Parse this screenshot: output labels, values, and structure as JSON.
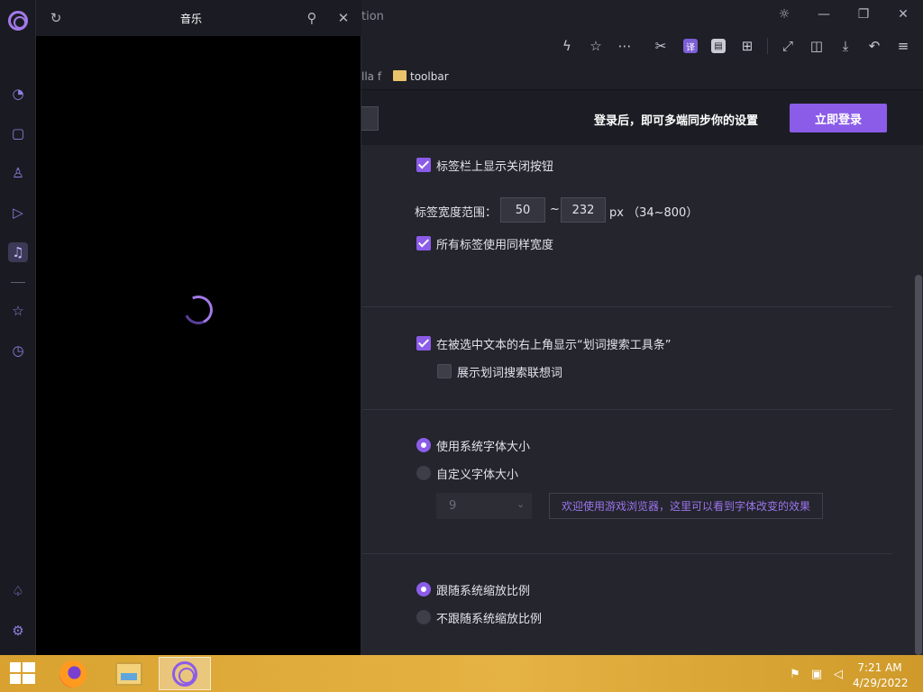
{
  "titlebar": {
    "controls": [
      "brightness-icon",
      "minimize-icon",
      "restore-icon",
      "close-icon"
    ]
  },
  "address": {
    "partial_text": "tion"
  },
  "toolbar": {
    "translate_badge": "译"
  },
  "bookmarks": {
    "partial_item": "lla f",
    "folder_label": "toolbar"
  },
  "banner": {
    "text": "登录后，即可多端同步你的设置",
    "login_label": "立即登录"
  },
  "tabs_section": {
    "show_close_btn": {
      "label": "标签栏上显示关闭按钮",
      "checked": true
    },
    "width_range_label": "标签宽度范围：",
    "width_min": "50",
    "tilde": "~",
    "width_max": "232",
    "unit_hint": "px （34~800）",
    "same_width": {
      "label": "所有标签使用同样宽度",
      "checked": true
    }
  },
  "selection_section": {
    "show_toolbar": {
      "label": "在被选中文本的右上角显示“划词搜索工具条”",
      "checked": true
    },
    "show_suggest": {
      "label": "展示划词搜索联想词",
      "checked": false
    }
  },
  "font_section": {
    "system_font": {
      "label": "使用系统字体大小",
      "selected": true
    },
    "custom_font": {
      "label": "自定义字体大小",
      "selected": false
    },
    "font_size_value": "9",
    "preview_text": "欢迎使用游戏浏览器，这里可以看到字体改变的效果"
  },
  "zoom_section": {
    "follow_system": {
      "label": "跟随系统缩放比例",
      "selected": true
    },
    "not_follow": {
      "label": "不跟随系统缩放比例",
      "selected": false
    }
  },
  "music_panel": {
    "title": "音乐",
    "loading": true
  },
  "sidebar": {
    "items": [
      "dashboard-icon",
      "screen-icon",
      "user-add-icon",
      "video-icon",
      "music-icon",
      "star-icon",
      "history-icon",
      "thumbs-up-icon",
      "settings-icon"
    ],
    "active": "music-icon"
  },
  "taskbar": {
    "apps": [
      "firefox",
      "file-explorer",
      "game-browser"
    ],
    "active_app": "game-browser",
    "clock_time": "7:21 AM",
    "clock_date": "4/29/2022"
  },
  "colors": {
    "accent": "#8b5ce8",
    "page_bg": "#24252d",
    "taskbar": "#e5b343"
  }
}
